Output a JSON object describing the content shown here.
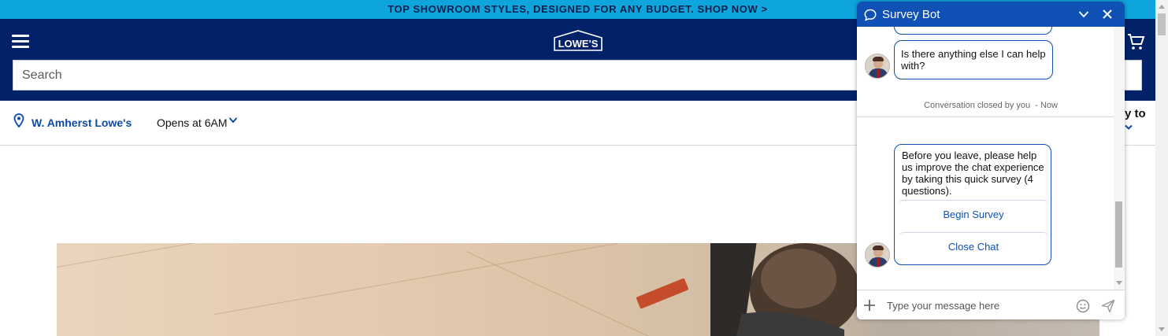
{
  "promo": {
    "text": "TOP SHOWROOM STYLES, DESIGNED FOR ANY BUDGET. SHOP NOW >"
  },
  "header": {
    "logo_text": "LOWE'S",
    "search": {
      "placeholder": "Search",
      "value": ""
    }
  },
  "store": {
    "name": "W. Amherst Lowe's",
    "hours": "Opens at 6AM",
    "delivery_partial": "y to"
  },
  "chat": {
    "title": "Survey Bot",
    "messages": {
      "anything_else": "Is there anything else I can help with?",
      "closed_note": "Conversation closed by you  - Now",
      "survey_prompt": "Before you leave, please help us improve the chat experience by taking this quick survey (4 questions)."
    },
    "buttons": {
      "begin": "Begin Survey",
      "close": "Close Chat"
    },
    "input": {
      "placeholder": "Type your message here",
      "value": ""
    }
  },
  "colors": {
    "promo_bg": "#0ea5dd",
    "header_bg": "#012169",
    "chat_header_bg": "#1051b6",
    "link_blue": "#0d4aa5"
  },
  "icons": [
    "menu-icon",
    "lowes-logo",
    "cart-icon",
    "location-pin-icon",
    "chevron-down-icon",
    "chat-bubble-icon",
    "minimize-icon",
    "close-icon",
    "plus-icon",
    "emoji-icon",
    "send-icon"
  ]
}
